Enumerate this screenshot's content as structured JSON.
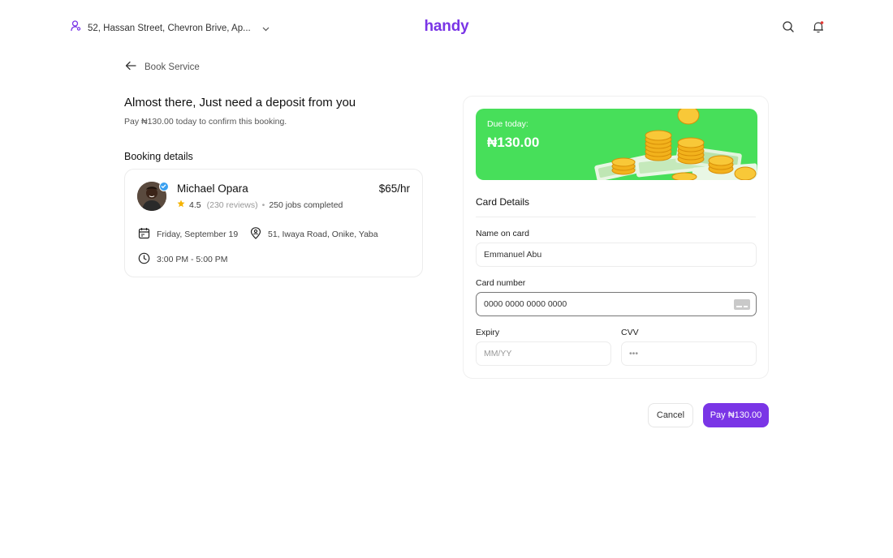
{
  "header": {
    "location": "52, Hassan Street, Chevron Brive, Ap...",
    "logo": "handy"
  },
  "back": {
    "label": "Book Service"
  },
  "page": {
    "title": "Almost there, Just need a deposit from you",
    "subtitle": "Pay ₦130.00 today to confirm this booking."
  },
  "booking": {
    "section_label": "Booking details",
    "pro_name": "Michael Opara",
    "rate": "$65/hr",
    "rating": "4.5",
    "reviews": "(230 reviews)",
    "jobs": "250 jobs completed",
    "date": "Friday, September 19",
    "address": "51, Iwaya Road, Onike, Yaba",
    "time": "3:00 PM - 5:00 PM"
  },
  "payment": {
    "due_label": "Due today:",
    "due_amount": "₦130.00",
    "card_details_title": "Card Details",
    "name_label": "Name on card",
    "name_value": "Emmanuel Abu",
    "number_label": "Card number",
    "number_value": "0000 0000 0000 0000",
    "expiry_label": "Expiry",
    "expiry_placeholder": "MM/YY",
    "cvv_label": "CVV",
    "cvv_placeholder": "•••"
  },
  "actions": {
    "cancel": "Cancel",
    "pay": "Pay ₦130.00"
  },
  "colors": {
    "brand": "#7a35e6",
    "due_card": "#47df5a",
    "star": "#f5b301",
    "verified": "#3aa0f0",
    "notification_dot": "#e53935"
  }
}
